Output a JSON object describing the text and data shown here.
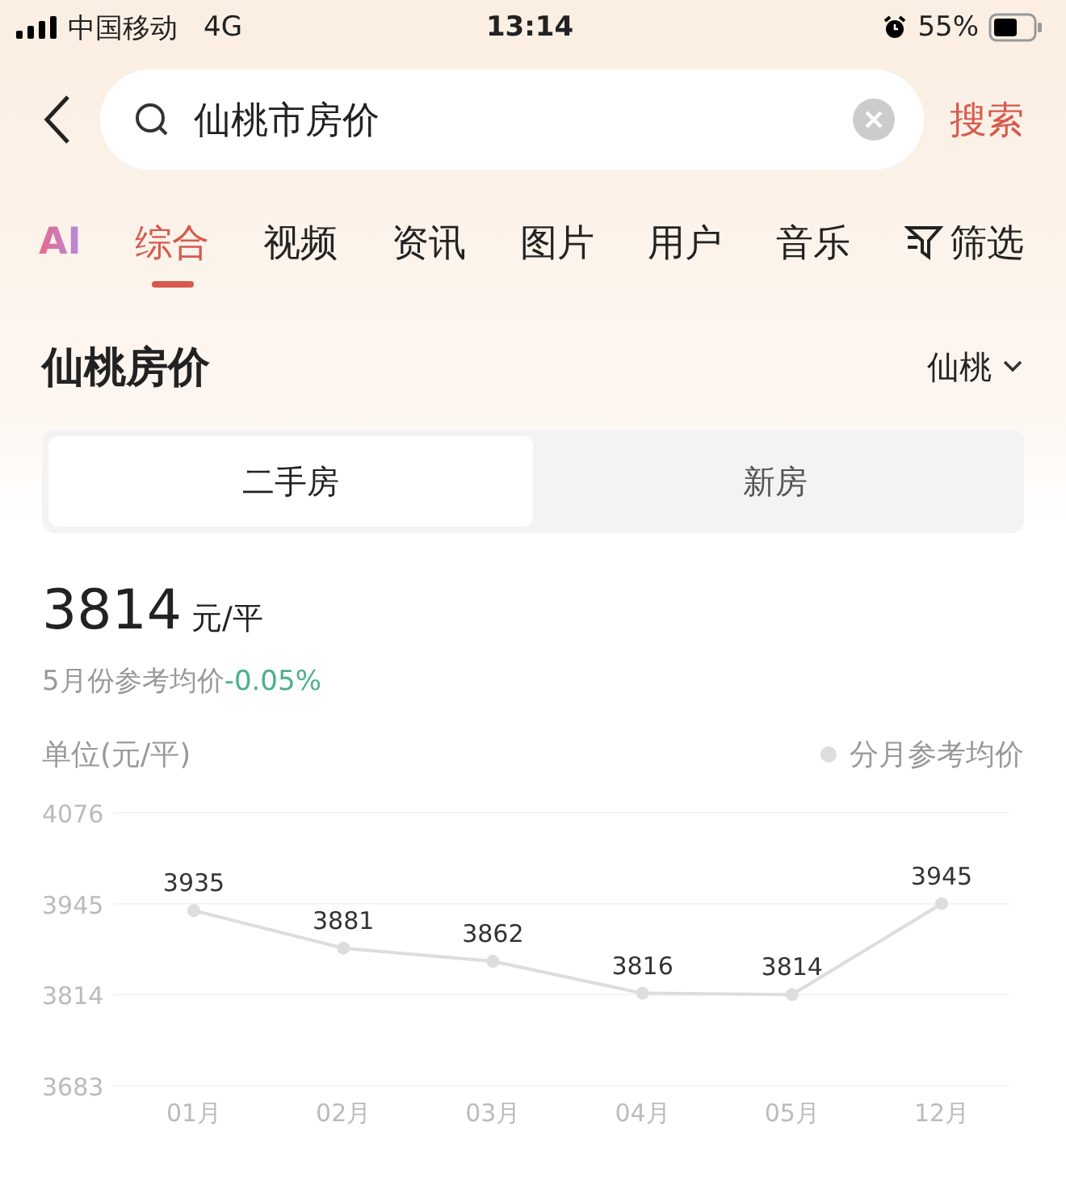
{
  "status_bar": {
    "carrier": "中国移动",
    "network": "4G",
    "time": "13:14",
    "battery": "55%"
  },
  "search": {
    "value": "仙桃市房价",
    "button": "搜索"
  },
  "tabs": [
    {
      "label": "AI",
      "kind": "logo",
      "selected": false
    },
    {
      "label": "综合",
      "kind": "text",
      "selected": true
    },
    {
      "label": "视频",
      "kind": "text",
      "selected": false
    },
    {
      "label": "资讯",
      "kind": "text",
      "selected": false
    },
    {
      "label": "图片",
      "kind": "text",
      "selected": false
    },
    {
      "label": "用户",
      "kind": "text",
      "selected": false
    },
    {
      "label": "音乐",
      "kind": "text",
      "selected": false
    }
  ],
  "filter": "筛选",
  "title": "仙桃房价",
  "city": "仙桃",
  "segments": [
    {
      "label": "二手房",
      "selected": true
    },
    {
      "label": "新房",
      "selected": false
    }
  ],
  "price": {
    "value": "3814",
    "unit": "元/平",
    "note": "5月份参考均价",
    "change": "-0.05%"
  },
  "chart": {
    "unit": "单位(元/平)",
    "chart_data": {
      "type": "line",
      "categories": [
        "01月",
        "02月",
        "03月",
        "04月",
        "05月",
        "12月"
      ],
      "series": [
        {
          "name": "分月参考均价",
          "color": "#dddddd",
          "marker": "circle",
          "values": [
            3935,
            3881,
            3862,
            3816,
            3814,
            3945
          ]
        }
      ],
      "ylim": [
        3683,
        4076
      ],
      "yticks": [
        3683,
        3814,
        3945,
        4076
      ],
      "data_labels": true
    }
  }
}
